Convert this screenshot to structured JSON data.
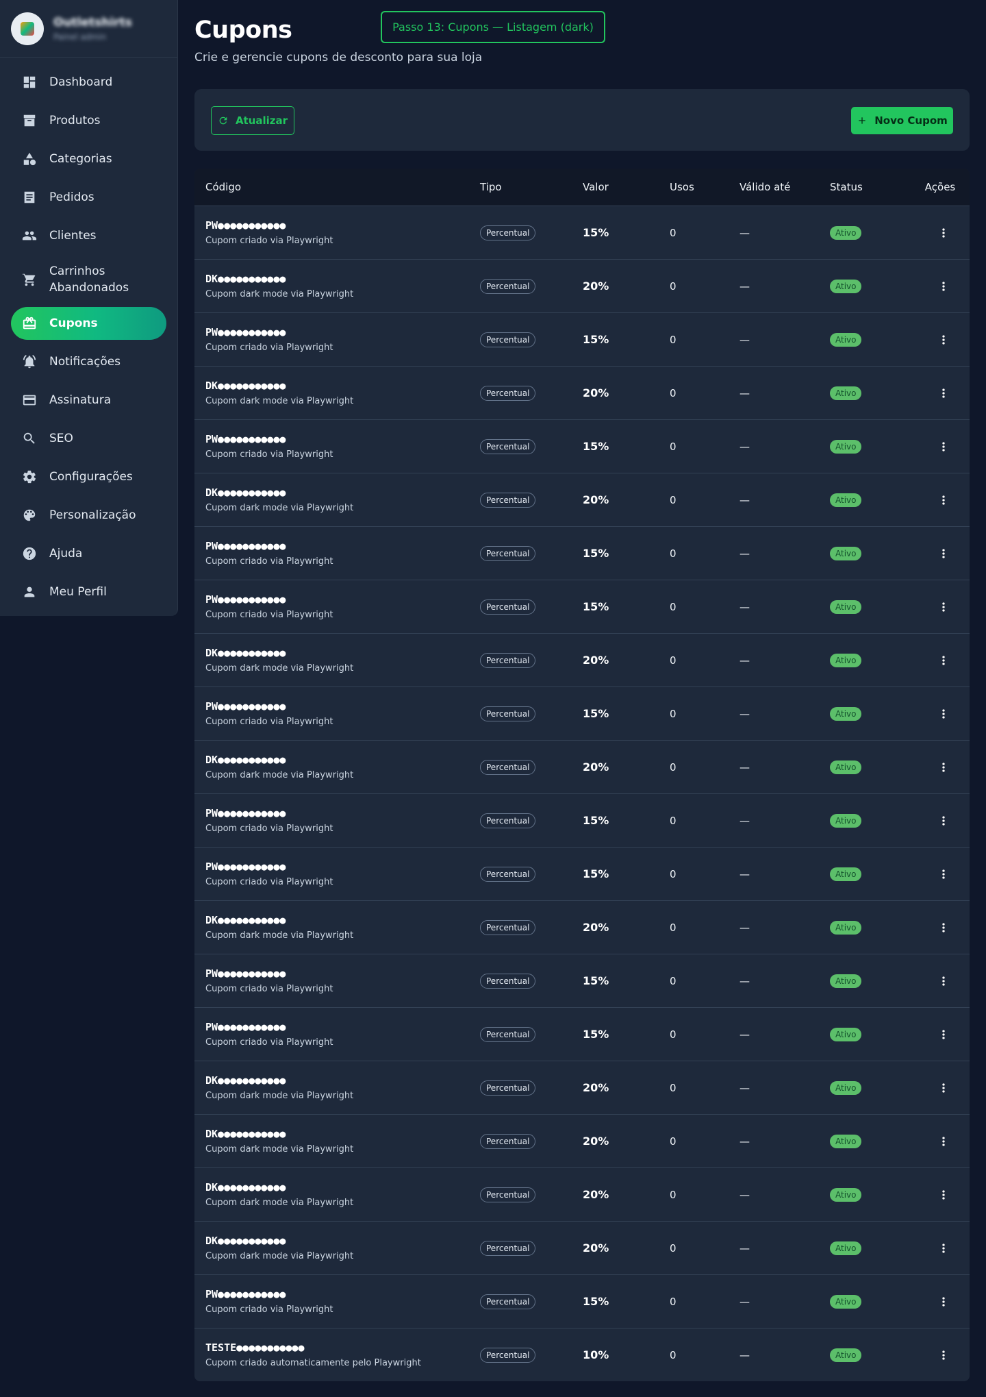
{
  "store": {
    "name": "Outletshirts",
    "subtitle": "Painel admin"
  },
  "sidebar": {
    "items": [
      {
        "label": "Dashboard",
        "icon": "dashboard-icon"
      },
      {
        "label": "Produtos",
        "icon": "archive-icon"
      },
      {
        "label": "Categorias",
        "icon": "category-icon"
      },
      {
        "label": "Pedidos",
        "icon": "receipt-icon"
      },
      {
        "label": "Clientes",
        "icon": "people-icon"
      },
      {
        "label": "Carrinhos Abandonados",
        "icon": "cart-icon"
      },
      {
        "label": "Cupons",
        "icon": "coupon-icon",
        "active": true
      },
      {
        "label": "Notificações",
        "icon": "bell-icon"
      },
      {
        "label": "Assinatura",
        "icon": "credit-card-icon"
      },
      {
        "label": "SEO",
        "icon": "search-icon"
      },
      {
        "label": "Configurações",
        "icon": "gear-icon"
      },
      {
        "label": "Personalização",
        "icon": "palette-icon"
      },
      {
        "label": "Ajuda",
        "icon": "help-icon"
      },
      {
        "label": "Meu Perfil",
        "icon": "person-icon"
      }
    ]
  },
  "header": {
    "title": "Cupons",
    "subtitle": "Crie e gerencie cupons de desconto para sua loja",
    "step_badge": "Passo 13: Cupons — Listagem (dark)"
  },
  "toolbar": {
    "refresh_label": "Atualizar",
    "new_label": "Novo Cupom"
  },
  "table": {
    "columns": [
      "Código",
      "Tipo",
      "Valor",
      "Usos",
      "Válido até",
      "Status",
      "Ações"
    ],
    "rows": [
      {
        "code": "PW●●●●●●●●●●●",
        "desc": "Cupom criado via Playwright",
        "tipo": "Percentual",
        "valor": "15%",
        "usos": "0",
        "valido": "—",
        "status": "Ativo"
      },
      {
        "code": "DK●●●●●●●●●●●",
        "desc": "Cupom dark mode via Playwright",
        "tipo": "Percentual",
        "valor": "20%",
        "usos": "0",
        "valido": "—",
        "status": "Ativo"
      },
      {
        "code": "PW●●●●●●●●●●●",
        "desc": "Cupom criado via Playwright",
        "tipo": "Percentual",
        "valor": "15%",
        "usos": "0",
        "valido": "—",
        "status": "Ativo"
      },
      {
        "code": "DK●●●●●●●●●●●",
        "desc": "Cupom dark mode via Playwright",
        "tipo": "Percentual",
        "valor": "20%",
        "usos": "0",
        "valido": "—",
        "status": "Ativo"
      },
      {
        "code": "PW●●●●●●●●●●●",
        "desc": "Cupom criado via Playwright",
        "tipo": "Percentual",
        "valor": "15%",
        "usos": "0",
        "valido": "—",
        "status": "Ativo"
      },
      {
        "code": "DK●●●●●●●●●●●",
        "desc": "Cupom dark mode via Playwright",
        "tipo": "Percentual",
        "valor": "20%",
        "usos": "0",
        "valido": "—",
        "status": "Ativo"
      },
      {
        "code": "PW●●●●●●●●●●●",
        "desc": "Cupom criado via Playwright",
        "tipo": "Percentual",
        "valor": "15%",
        "usos": "0",
        "valido": "—",
        "status": "Ativo"
      },
      {
        "code": "PW●●●●●●●●●●●",
        "desc": "Cupom criado via Playwright",
        "tipo": "Percentual",
        "valor": "15%",
        "usos": "0",
        "valido": "—",
        "status": "Ativo"
      },
      {
        "code": "DK●●●●●●●●●●●",
        "desc": "Cupom dark mode via Playwright",
        "tipo": "Percentual",
        "valor": "20%",
        "usos": "0",
        "valido": "—",
        "status": "Ativo"
      },
      {
        "code": "PW●●●●●●●●●●●",
        "desc": "Cupom criado via Playwright",
        "tipo": "Percentual",
        "valor": "15%",
        "usos": "0",
        "valido": "—",
        "status": "Ativo"
      },
      {
        "code": "DK●●●●●●●●●●●",
        "desc": "Cupom dark mode via Playwright",
        "tipo": "Percentual",
        "valor": "20%",
        "usos": "0",
        "valido": "—",
        "status": "Ativo"
      },
      {
        "code": "PW●●●●●●●●●●●",
        "desc": "Cupom criado via Playwright",
        "tipo": "Percentual",
        "valor": "15%",
        "usos": "0",
        "valido": "—",
        "status": "Ativo"
      },
      {
        "code": "PW●●●●●●●●●●●",
        "desc": "Cupom criado via Playwright",
        "tipo": "Percentual",
        "valor": "15%",
        "usos": "0",
        "valido": "—",
        "status": "Ativo"
      },
      {
        "code": "DK●●●●●●●●●●●",
        "desc": "Cupom dark mode via Playwright",
        "tipo": "Percentual",
        "valor": "20%",
        "usos": "0",
        "valido": "—",
        "status": "Ativo"
      },
      {
        "code": "PW●●●●●●●●●●●",
        "desc": "Cupom criado via Playwright",
        "tipo": "Percentual",
        "valor": "15%",
        "usos": "0",
        "valido": "—",
        "status": "Ativo"
      },
      {
        "code": "PW●●●●●●●●●●●",
        "desc": "Cupom criado via Playwright",
        "tipo": "Percentual",
        "valor": "15%",
        "usos": "0",
        "valido": "—",
        "status": "Ativo"
      },
      {
        "code": "DK●●●●●●●●●●●",
        "desc": "Cupom dark mode via Playwright",
        "tipo": "Percentual",
        "valor": "20%",
        "usos": "0",
        "valido": "—",
        "status": "Ativo"
      },
      {
        "code": "DK●●●●●●●●●●●",
        "desc": "Cupom dark mode via Playwright",
        "tipo": "Percentual",
        "valor": "20%",
        "usos": "0",
        "valido": "—",
        "status": "Ativo"
      },
      {
        "code": "DK●●●●●●●●●●●",
        "desc": "Cupom dark mode via Playwright",
        "tipo": "Percentual",
        "valor": "20%",
        "usos": "0",
        "valido": "—",
        "status": "Ativo"
      },
      {
        "code": "DK●●●●●●●●●●●",
        "desc": "Cupom dark mode via Playwright",
        "tipo": "Percentual",
        "valor": "20%",
        "usos": "0",
        "valido": "—",
        "status": "Ativo"
      },
      {
        "code": "PW●●●●●●●●●●●",
        "desc": "Cupom criado via Playwright",
        "tipo": "Percentual",
        "valor": "15%",
        "usos": "0",
        "valido": "—",
        "status": "Ativo"
      },
      {
        "code": "TESTE●●●●●●●●●●●",
        "desc": "Cupom criado automaticamente pelo Playwright",
        "tipo": "Percentual",
        "valor": "10%",
        "usos": "0",
        "valido": "—",
        "status": "Ativo"
      }
    ]
  },
  "colors": {
    "background": "#0f172a",
    "panel": "#1e293b",
    "accent": "#22c55e",
    "status_active": "#5cbf6a"
  }
}
